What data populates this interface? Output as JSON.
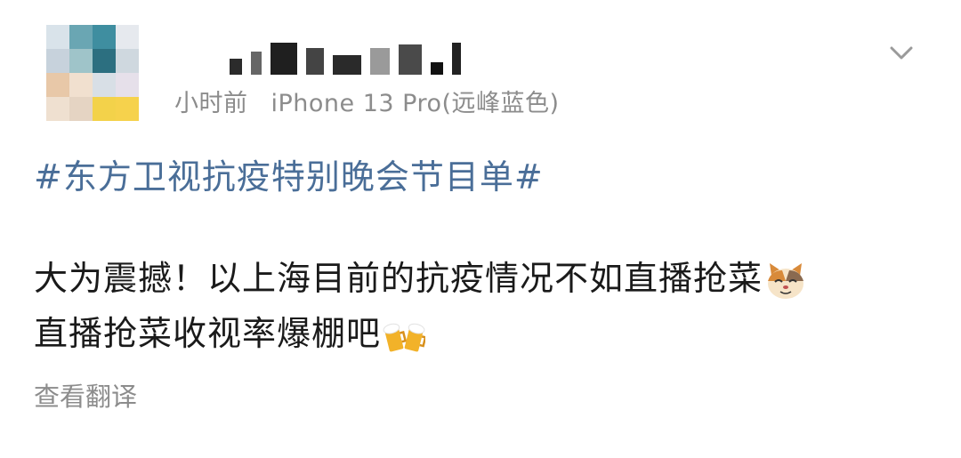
{
  "post": {
    "time": "小时前",
    "device": "iPhone 13 Pro(远峰蓝色)",
    "topic": "#东方卫视抗疫特别晚会节目单#",
    "line1": "大为震撼！以上海目前的抗疫情况不如直播抢菜",
    "line2": "直播抢菜收视率爆棚吧",
    "translate": "查看翻译"
  },
  "icons": {
    "menu": "chevron-down-icon",
    "emoji1": "cat-face-emoji",
    "emoji2": "beer-mugs-emoji"
  },
  "colors": {
    "topic_link": "#4a6e98",
    "meta_text": "#8c8c8c",
    "body_text": "#1a1a1a"
  }
}
